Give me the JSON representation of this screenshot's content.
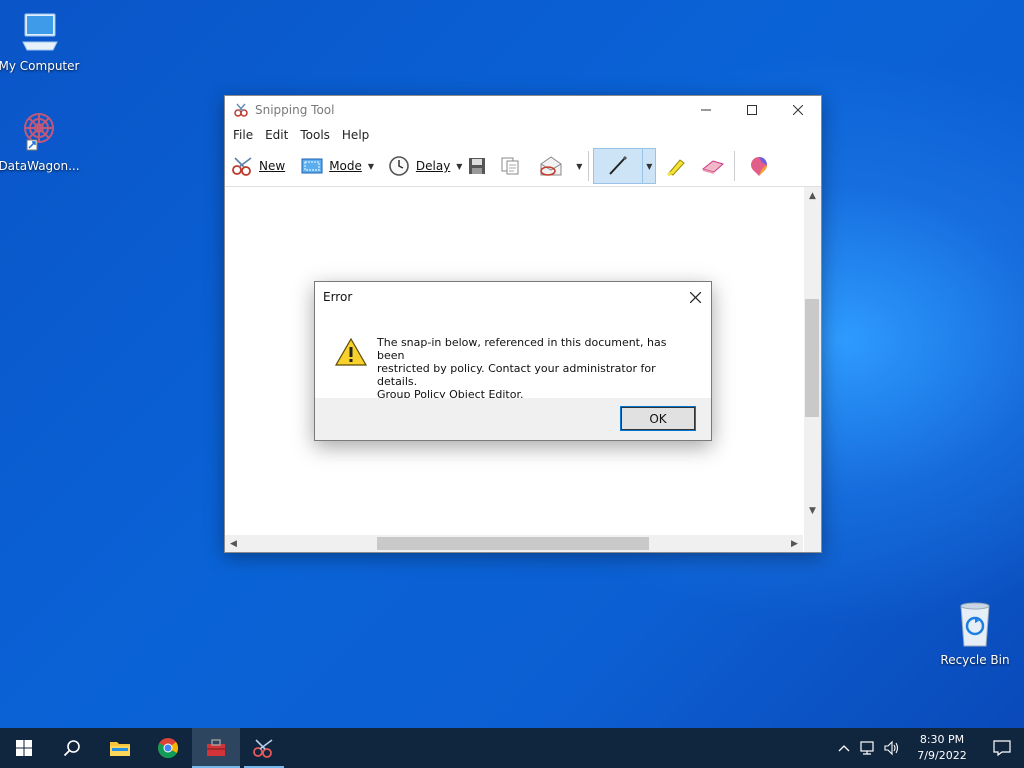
{
  "desktop": {
    "icons": [
      {
        "label": "My Computer"
      },
      {
        "label": "DataWagon..."
      },
      {
        "label": "Recycle Bin"
      }
    ]
  },
  "snipping_tool": {
    "title": "Snipping Tool",
    "menu": [
      "File",
      "Edit",
      "Tools",
      "Help"
    ],
    "toolbar": {
      "new_label": "New",
      "mode_label": "Mode",
      "delay_label": "Delay"
    }
  },
  "error_dialog": {
    "title": "Error",
    "message_line1": "The snap-in below, referenced in this document, has been",
    "message_line2": "restricted by policy. Contact your administrator for details.",
    "message_line3": "Group Policy Object Editor.",
    "ok_label": "OK"
  },
  "taskbar": {
    "time": "8:30 PM",
    "date": "7/9/2022"
  }
}
